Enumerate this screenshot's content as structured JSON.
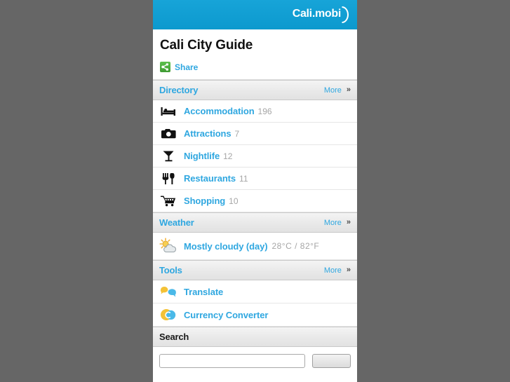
{
  "header": {
    "logo_text": "Cali.mobi",
    "logo_icon": "arc-icon",
    "bg_color": "#0e9dd2"
  },
  "title": {
    "page_title": "Cali City Guide",
    "share_label": "Share",
    "share_icon": "share-icon",
    "share_icon_color": "#4caf3f"
  },
  "link_color": "#2fa7e0",
  "sections": [
    {
      "id": "directory",
      "title": "Directory",
      "more_label": "More",
      "more_chevron": "»",
      "items": [
        {
          "icon": "bed-icon",
          "label": "Accommodation",
          "count": "196"
        },
        {
          "icon": "camera-icon",
          "label": "Attractions",
          "count": "7"
        },
        {
          "icon": "cocktail-glass-icon",
          "label": "Nightlife",
          "count": "12"
        },
        {
          "icon": "fork-knife-icon",
          "label": "Restaurants",
          "count": "11"
        },
        {
          "icon": "shopping-cart-icon",
          "label": "Shopping",
          "count": "10"
        }
      ]
    },
    {
      "id": "weather",
      "title": "Weather",
      "more_label": "More",
      "more_chevron": "»",
      "items": [
        {
          "icon": "sun-behind-cloud-icon",
          "label": "Mostly cloudy (day)",
          "count": "28°C / 82°F"
        }
      ]
    },
    {
      "id": "tools",
      "title": "Tools",
      "more_label": "More",
      "more_chevron": "»",
      "items": [
        {
          "icon": "speech-bubbles-icon",
          "label": "Translate",
          "count": ""
        },
        {
          "icon": "currency-coins-icon",
          "label": "Currency Converter",
          "count": ""
        }
      ]
    }
  ],
  "search": {
    "title": "Search",
    "value": "",
    "placeholder": "",
    "button_label": ""
  }
}
